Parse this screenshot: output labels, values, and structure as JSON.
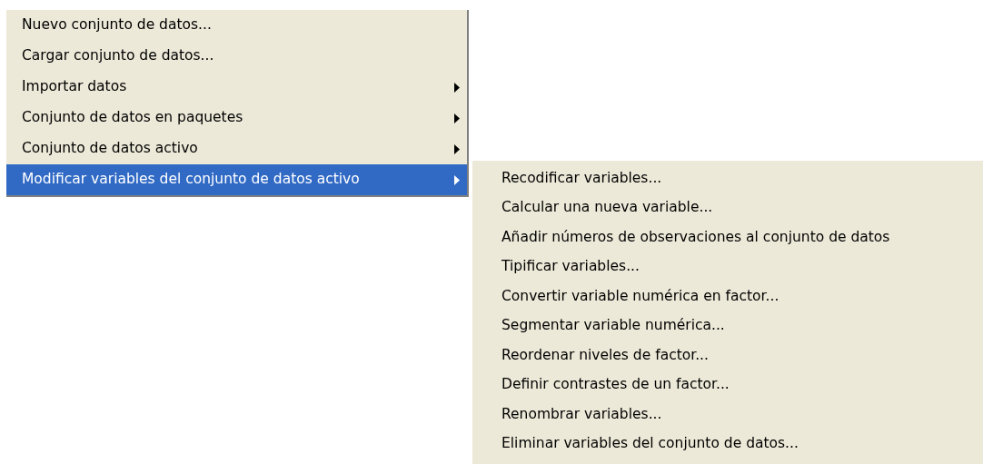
{
  "menu": {
    "items": [
      {
        "label": "Nuevo conjunto de datos...",
        "submenu": false,
        "selected": false
      },
      {
        "label": "Cargar conjunto de datos...",
        "submenu": false,
        "selected": false
      },
      {
        "label": "Importar datos",
        "submenu": true,
        "selected": false
      },
      {
        "label": "Conjunto de datos en paquetes",
        "submenu": true,
        "selected": false
      },
      {
        "label": "Conjunto de datos activo",
        "submenu": true,
        "selected": false
      },
      {
        "label": "Modificar variables del conjunto de datos activo",
        "submenu": true,
        "selected": true
      }
    ]
  },
  "submenu": {
    "items": [
      {
        "label": "Recodificar variables..."
      },
      {
        "label": "Calcular una nueva variable..."
      },
      {
        "label": "Añadir números de observaciones al conjunto de datos"
      },
      {
        "label": "Tipificar variables..."
      },
      {
        "label": "Convertir variable numérica en factor..."
      },
      {
        "label": "Segmentar variable numérica..."
      },
      {
        "label": "Reordenar niveles de factor..."
      },
      {
        "label": "Definir contrastes de un factor..."
      },
      {
        "label": "Renombrar variables..."
      },
      {
        "label": "Eliminar variables del conjunto de datos..."
      }
    ]
  }
}
